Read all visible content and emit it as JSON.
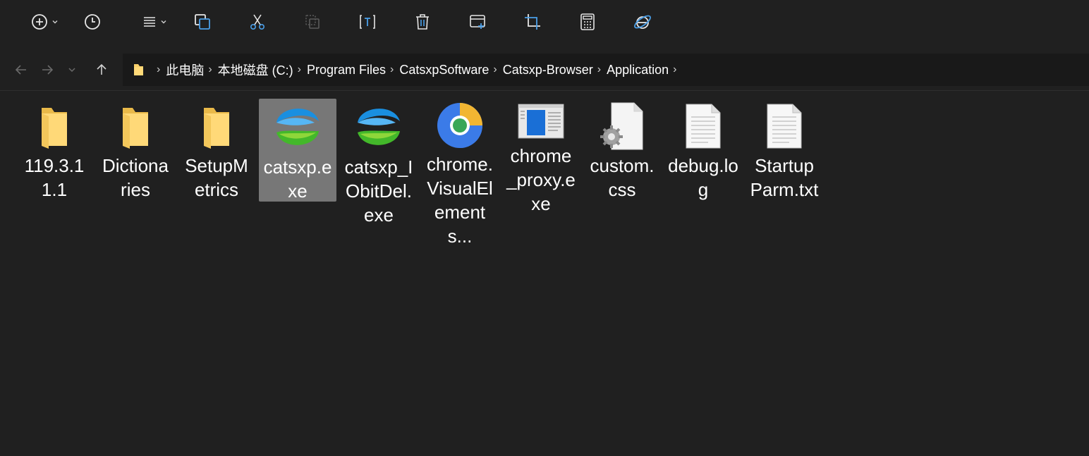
{
  "toolbar": {
    "items": [
      {
        "id": "new",
        "icon": "plus-circle-icon",
        "has_caret": true
      },
      {
        "id": "recent",
        "icon": "clock-icon",
        "has_caret": false
      },
      {
        "id": "view",
        "icon": "list-icon",
        "has_caret": true
      },
      {
        "id": "copy",
        "icon": "copy-icon"
      },
      {
        "id": "cut",
        "icon": "scissors-icon"
      },
      {
        "id": "paste",
        "icon": "paste-icon",
        "disabled": true
      },
      {
        "id": "rename",
        "icon": "rename-icon"
      },
      {
        "id": "delete",
        "icon": "trash-icon"
      },
      {
        "id": "new-window",
        "icon": "window-add-icon"
      },
      {
        "id": "crop",
        "icon": "crop-icon"
      },
      {
        "id": "calculator",
        "icon": "calculator-icon"
      },
      {
        "id": "ie",
        "icon": "ie-icon"
      }
    ],
    "accent": "#4a9fe8"
  },
  "breadcrumb": [
    "此电脑",
    "本地磁盘 (C:)",
    "Program Files",
    "CatsxpSoftware",
    "Catsxp-Browser",
    "Application"
  ],
  "files": [
    {
      "name": "119.3.11.1",
      "type": "folder"
    },
    {
      "name": "Dictionaries",
      "type": "folder"
    },
    {
      "name": "SetupMetrics",
      "type": "folder"
    },
    {
      "name": "catsxp.exe",
      "type": "catsxp",
      "selected": true
    },
    {
      "name": "catsxp_IObitDel.exe",
      "type": "catsxp"
    },
    {
      "name": "chrome.VisualElements...",
      "type": "chrome"
    },
    {
      "name": "chrome_proxy.exe",
      "type": "window-app"
    },
    {
      "name": "custom.css",
      "type": "css"
    },
    {
      "name": "debug.log",
      "type": "text"
    },
    {
      "name": "StartupParm.txt",
      "type": "text"
    }
  ]
}
